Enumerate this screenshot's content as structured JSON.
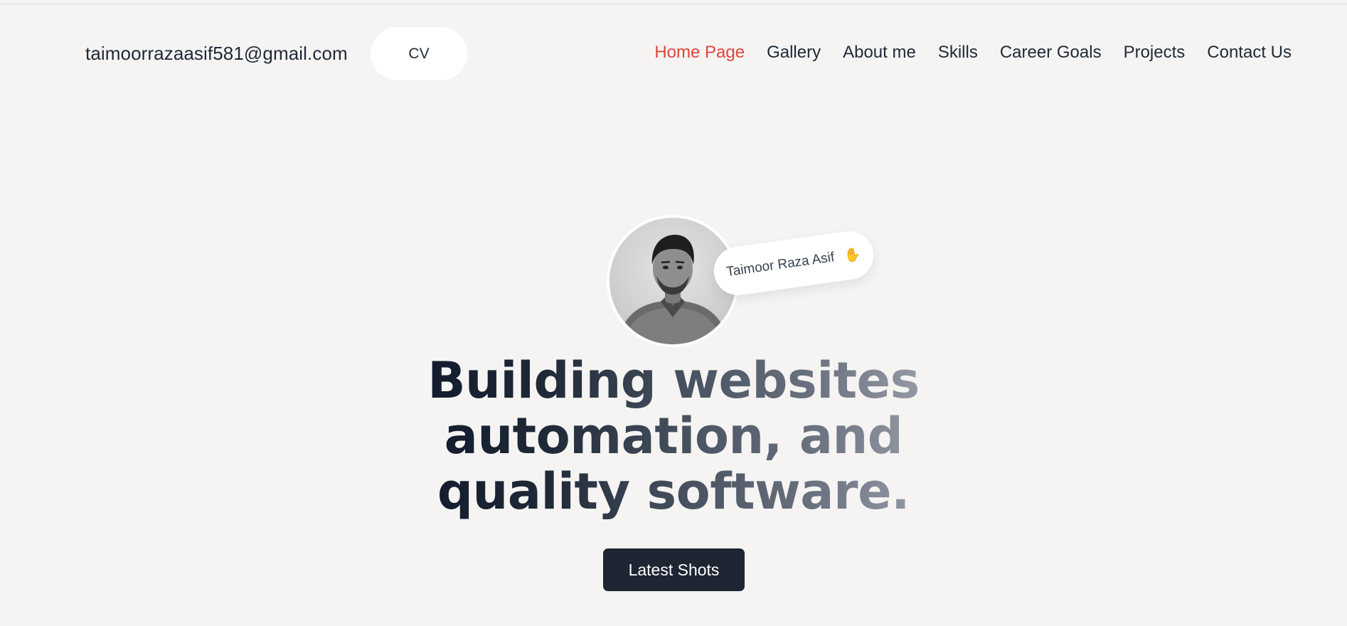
{
  "header": {
    "email": "taimoorrazaasif581@gmail.com",
    "cv_label": "CV",
    "nav": [
      {
        "label": "Home Page",
        "active": true
      },
      {
        "label": "Gallery",
        "active": false
      },
      {
        "label": "About me",
        "active": false
      },
      {
        "label": "Skills",
        "active": false
      },
      {
        "label": "Career Goals",
        "active": false
      },
      {
        "label": "Projects",
        "active": false
      },
      {
        "label": "Contact Us",
        "active": false
      }
    ]
  },
  "hero": {
    "name_tag": "Taimoor Raza Asif",
    "name_tag_icon": "waving-hand-icon",
    "headline_lines": [
      "Building websites",
      "automation, and",
      "quality software."
    ],
    "cta_label": "Latest Shots"
  },
  "colors": {
    "background": "#f5f4f3",
    "accent": "#e0453d",
    "text": "#1f2937",
    "button_bg": "#1e2533"
  }
}
